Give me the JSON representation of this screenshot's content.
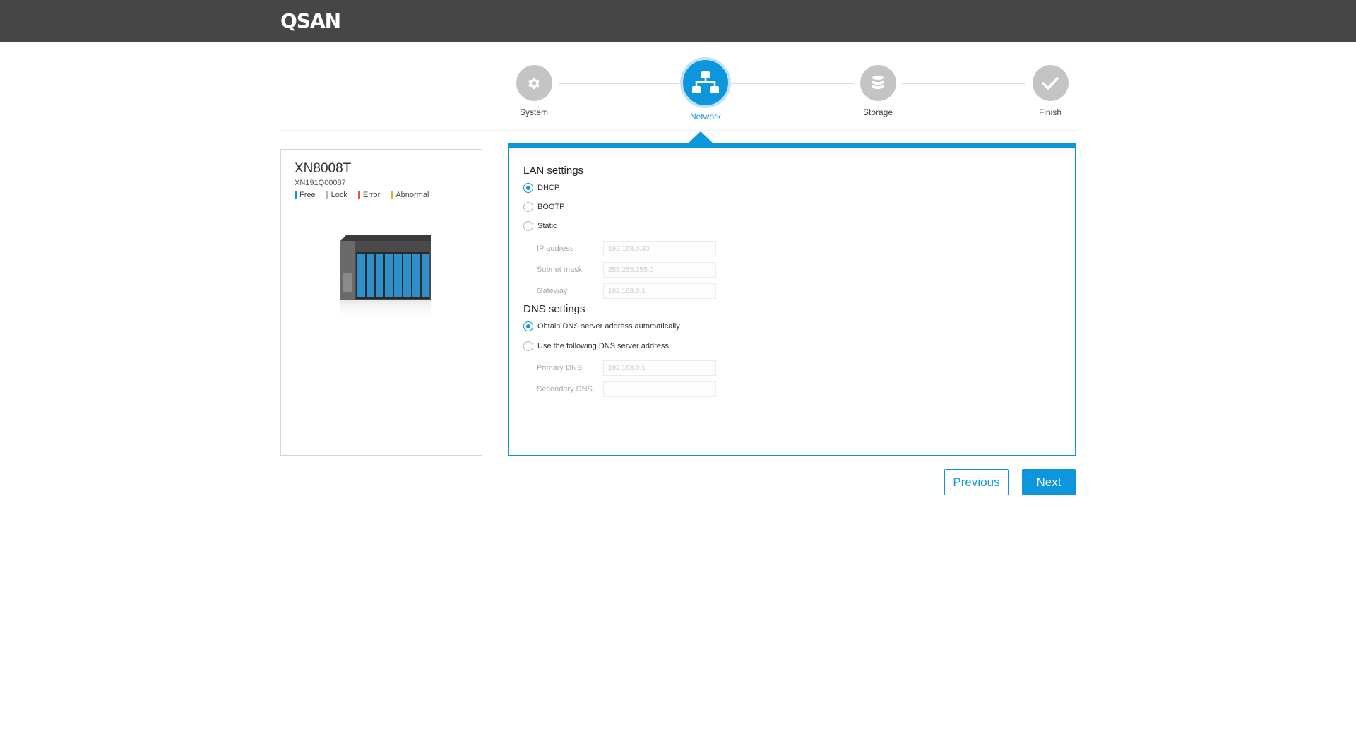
{
  "header": {
    "logo": "QSAN"
  },
  "steps": [
    {
      "label": "System",
      "icon": "gear-icon",
      "state": "done"
    },
    {
      "label": "Network",
      "icon": "network-icon",
      "state": "active"
    },
    {
      "label": "Storage",
      "icon": "database-icon",
      "state": "pending"
    },
    {
      "label": "Finish",
      "icon": "check-icon",
      "state": "pending"
    }
  ],
  "device": {
    "model": "XN8008T",
    "serial": "XN191Q00087",
    "legend": [
      {
        "label": "Free",
        "color": "#0e96dc"
      },
      {
        "label": "Lock",
        "color": "#b8b8b8"
      },
      {
        "label": "Error",
        "color": "#e8572a"
      },
      {
        "label": "Abnormal",
        "color": "#f5a623"
      }
    ]
  },
  "lan": {
    "title": "LAN settings",
    "options": [
      {
        "label": "DHCP",
        "checked": true
      },
      {
        "label": "BOOTP",
        "checked": false
      },
      {
        "label": "Static",
        "checked": false
      }
    ],
    "fields": [
      {
        "label": "IP address",
        "placeholder": "192.168.0.30"
      },
      {
        "label": "Subnet mask",
        "placeholder": "255.255.255.0"
      },
      {
        "label": "Gateway",
        "placeholder": "192.168.0.1"
      }
    ]
  },
  "dns": {
    "title": "DNS settings",
    "options": [
      {
        "label": "Obtain DNS server address automatically",
        "checked": true
      },
      {
        "label": "Use the following DNS server address",
        "checked": false
      }
    ],
    "fields": [
      {
        "label": "Primary DNS",
        "placeholder": "192.168.0.1"
      },
      {
        "label": "Secondary DNS",
        "placeholder": ""
      }
    ]
  },
  "buttons": {
    "previous": "Previous",
    "next": "Next"
  },
  "colors": {
    "accent": "#0e96dc",
    "topbar": "#464646",
    "inactive_step": "#c4c4c4"
  }
}
